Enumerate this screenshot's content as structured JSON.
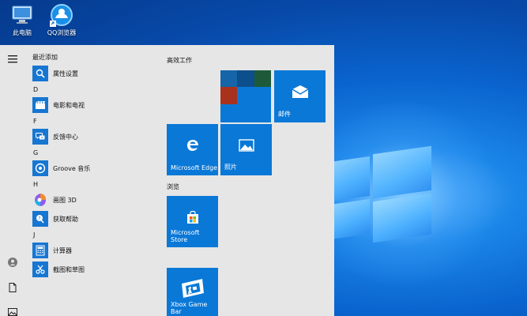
{
  "desktop": {
    "icons": [
      {
        "label": "此电脑",
        "icon": "computer-icon"
      },
      {
        "label": "QQ浏览器",
        "icon": "qq-browser-icon"
      }
    ]
  },
  "start_menu": {
    "recent_header": "最近添加",
    "recent_apps": [
      {
        "name": "属性设置",
        "icon": "properties-icon"
      }
    ],
    "groups": [
      {
        "letter": "D",
        "apps": [
          {
            "name": "电影和电视",
            "icon": "film-icon"
          }
        ]
      },
      {
        "letter": "F",
        "apps": [
          {
            "name": "反馈中心",
            "icon": "feedback-icon"
          }
        ]
      },
      {
        "letter": "G",
        "apps": [
          {
            "name": "Groove 音乐",
            "icon": "groove-icon"
          }
        ]
      },
      {
        "letter": "H",
        "apps": [
          {
            "name": "画图 3D",
            "icon": "paint3d-icon"
          },
          {
            "name": "获取帮助",
            "icon": "help-icon"
          }
        ]
      },
      {
        "letter": "J",
        "apps": [
          {
            "name": "计算器",
            "icon": "calculator-icon"
          },
          {
            "name": "截图和草图",
            "icon": "snip-icon"
          }
        ]
      }
    ],
    "sections": {
      "productivity": "高效工作",
      "browse": "浏览"
    },
    "tiles": {
      "mail": "邮件",
      "edge": "Microsoft Edge",
      "photos": "照片",
      "store": "Microsoft Store",
      "xbox": "Xbox Game Bar"
    },
    "colors": {
      "tile_blue": "#0a78d7",
      "menu_bg": "#e6e6e6",
      "mini_tile_1": "#1565a8",
      "mini_tile_2": "#0d4e8c",
      "mini_tile_3": "#10395f",
      "mini_tile_4": "#1e5a3a",
      "mini_tile_red": "#a8321e"
    }
  }
}
